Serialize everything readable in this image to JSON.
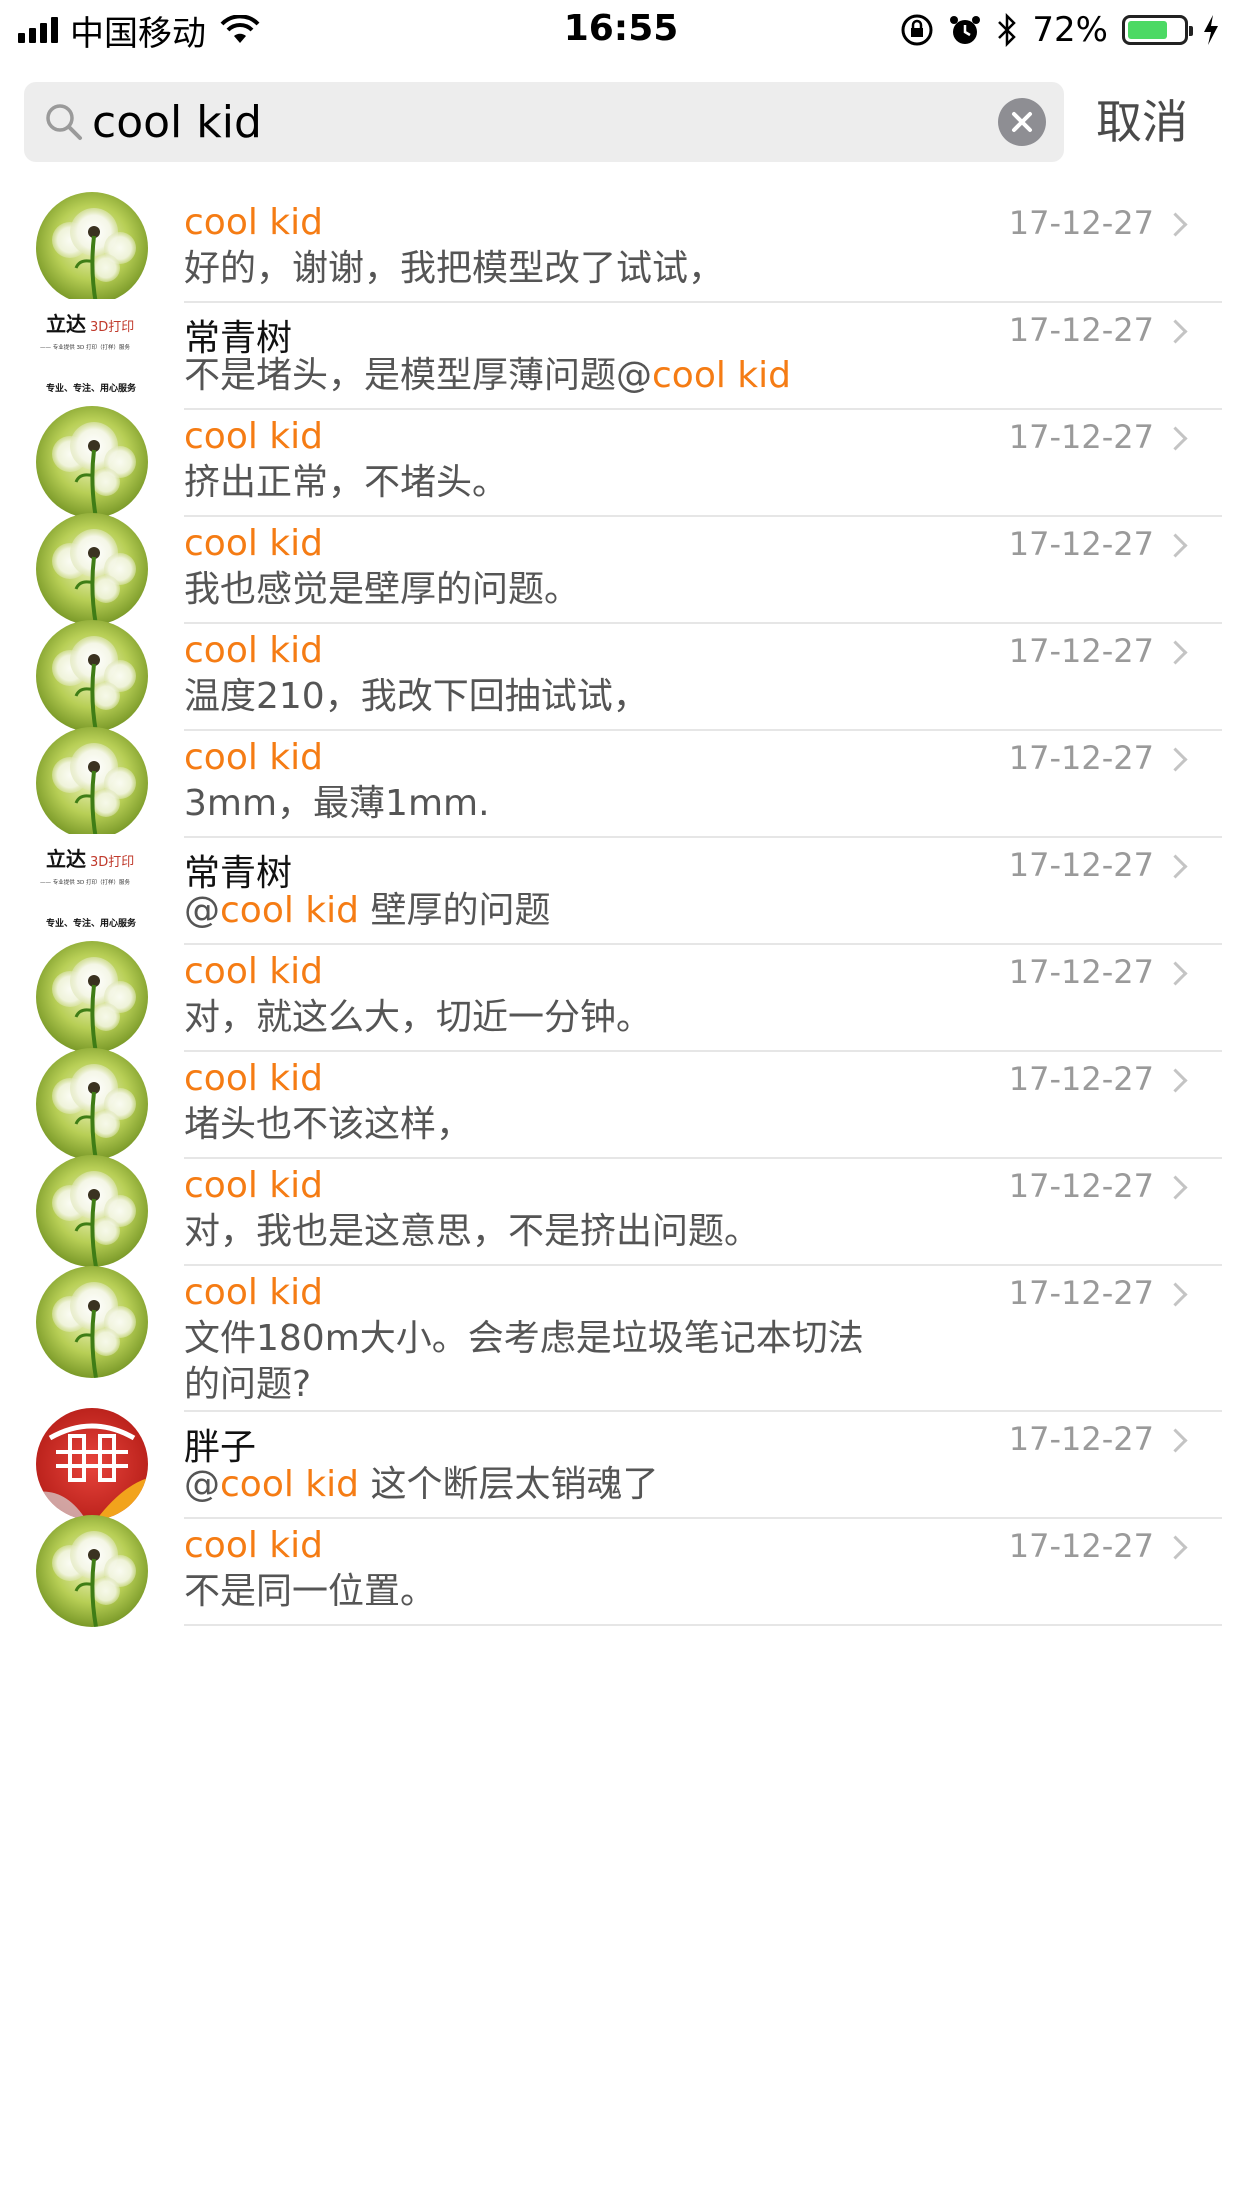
{
  "status_bar": {
    "carrier": "中国移动",
    "time": "16:55",
    "battery_percent_label": "72%",
    "battery_level": 0.72,
    "icons": [
      "signal-icon",
      "wifi-icon",
      "orientation-lock-icon",
      "alarm-icon",
      "bluetooth-icon",
      "battery-icon",
      "charging-icon"
    ]
  },
  "search": {
    "query": "cool kid",
    "cancel_label": "取消"
  },
  "colors": {
    "highlight": "#f57c14",
    "date": "#9a9a9a",
    "message": "#555555"
  },
  "results": [
    {
      "sender": "cool kid",
      "date": "17-12-27",
      "message": "好的，谢谢，我把模型改了试试，",
      "avatar": "dandelion-avatar"
    },
    {
      "sender": "常青树",
      "date": "17-12-27",
      "message_pre": "不是堵头，是模型厚薄问题@",
      "message_hl": "cool kid",
      "message_post": "",
      "avatar": "logo-avatar",
      "logo_title": "立达",
      "logo_3d": "3D打印",
      "logo_sub": "—— 专业提供 3D 打印（打样）服务",
      "logo_tagline": "专业、专注、用心服务"
    },
    {
      "sender": "cool kid",
      "date": "17-12-27",
      "message": "挤出正常，不堵头。",
      "avatar": "dandelion-avatar"
    },
    {
      "sender": "cool kid",
      "date": "17-12-27",
      "message": "我也感觉是壁厚的问题。",
      "avatar": "dandelion-avatar"
    },
    {
      "sender": "cool kid",
      "date": "17-12-27",
      "message": "温度210，我改下回抽试试，",
      "avatar": "dandelion-avatar"
    },
    {
      "sender": "cool kid",
      "date": "17-12-27",
      "message": "3mm，最薄1mm.",
      "avatar": "dandelion-avatar"
    },
    {
      "sender": "常青树",
      "date": "17-12-27",
      "message_pre": "@",
      "message_hl": "cool kid",
      "message_post": " 壁厚的问题",
      "avatar": "logo-avatar",
      "logo_title": "立达",
      "logo_3d": "3D打印",
      "logo_sub": "—— 专业提供 3D 打印（打样）服务",
      "logo_tagline": "专业、专注、用心服务"
    },
    {
      "sender": "cool kid",
      "date": "17-12-27",
      "message": "对，就这么大，切近一分钟。",
      "avatar": "dandelion-avatar"
    },
    {
      "sender": "cool kid",
      "date": "17-12-27",
      "message": "堵头也不该这样，",
      "avatar": "dandelion-avatar"
    },
    {
      "sender": "cool kid",
      "date": "17-12-27",
      "message": "对，我也是这意思，不是挤出问题。",
      "avatar": "dandelion-avatar"
    },
    {
      "sender": "cool kid",
      "date": "17-12-27",
      "message": "文件180m大小。会考虑是垃圾笔记本切法的问题?",
      "avatar": "dandelion-avatar"
    },
    {
      "sender": "胖子",
      "date": "17-12-27",
      "message_pre": "@",
      "message_hl": "cool kid",
      "message_post": " 这个断层太销魂了",
      "avatar": "red-pattern-avatar"
    },
    {
      "sender": "cool kid",
      "date": "17-12-27",
      "message": "不是同一位置。",
      "avatar": "dandelion-avatar"
    }
  ]
}
